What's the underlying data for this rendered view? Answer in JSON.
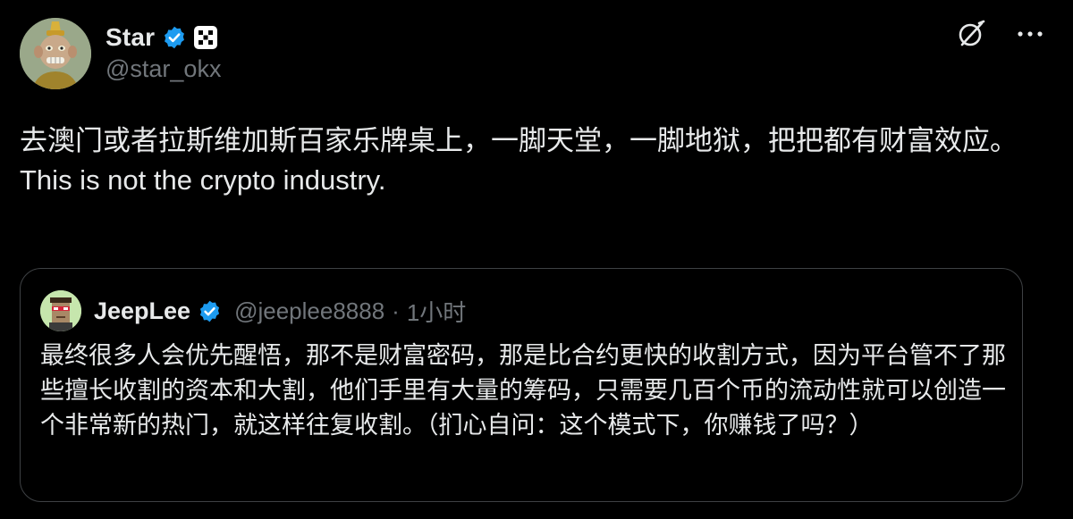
{
  "author": {
    "display_name": "Star",
    "handle": "@star_okx",
    "verified": true,
    "affiliate_badge_icon": "okx-logo-icon"
  },
  "actions": {
    "grok_icon": "grok-icon",
    "more_icon": "more-icon"
  },
  "post": {
    "text": "去澳门或者拉斯维加斯百家乐牌桌上，一脚天堂，一脚地狱，把把都有财富效应。\nThis is not the crypto industry."
  },
  "quoted_post": {
    "display_name": "JeepLee",
    "handle": "@jeeplee8888",
    "separator": "·",
    "timestamp": "1小时",
    "verified": true,
    "text": "最终很多人会优先醒悟，那不是财富密码，那是比合约更快的收割方式，因为平台管不了那些擅长收割的资本和大割，他们手里有大量的筹码，只需要几百个币的流动性就可以创造一个非常新的热门，就这样往复收割。（扪心自问：这个模式下，你赚钱了吗？）"
  },
  "colors": {
    "background": "#000000",
    "text_primary": "#e7e9ea",
    "text_secondary": "#71767b",
    "verified_blue": "#1d9bf0",
    "border": "#3e4144"
  }
}
